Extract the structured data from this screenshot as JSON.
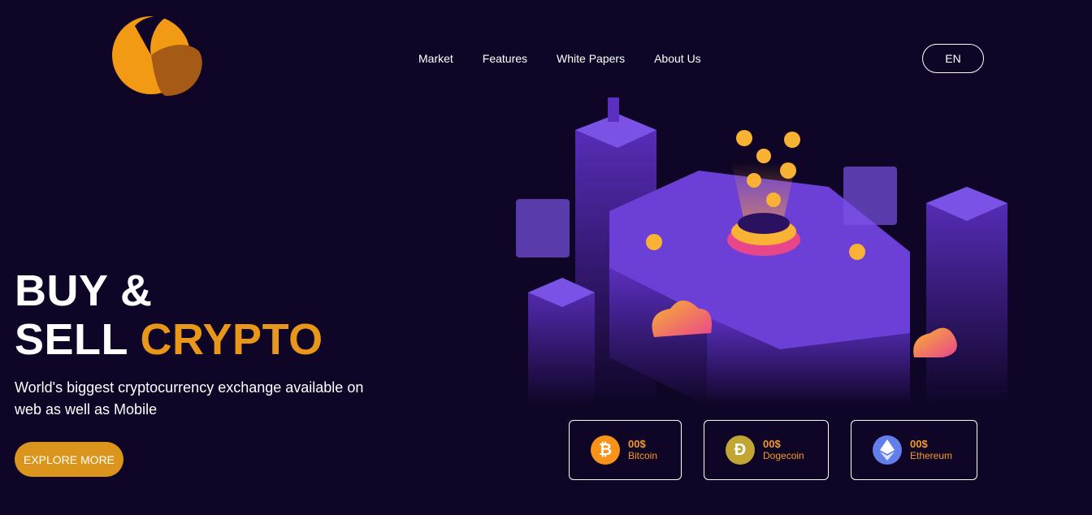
{
  "header": {
    "logo_icon": "crescent-logo-icon",
    "nav": [
      "Market",
      "Features",
      "White Papers",
      "About Us"
    ],
    "lang": "EN"
  },
  "hero": {
    "title_line1": "BUY &",
    "title_line2_white": "SELL ",
    "title_line2_accent": "CRYPTO",
    "subtitle": "World's biggest cryptocurrency exchange available on web as well as Mobile",
    "cta": "EXPLORE MORE"
  },
  "coins": [
    {
      "price": "00$",
      "name": "Bitcoin",
      "icon": "bitcoin-icon",
      "color": "#f7931a"
    },
    {
      "price": "00$",
      "name": "Dogecoin",
      "icon": "dogecoin-icon",
      "color": "#c2a633"
    },
    {
      "price": "00$",
      "name": "Ethereum",
      "icon": "ethereum-icon",
      "color": "#627eea"
    }
  ],
  "colors": {
    "background": "#0f0526",
    "accent": "#e8971a",
    "button": "#dc951c",
    "coin_text": "#f59a29",
    "purple": "#6c3fd6"
  }
}
